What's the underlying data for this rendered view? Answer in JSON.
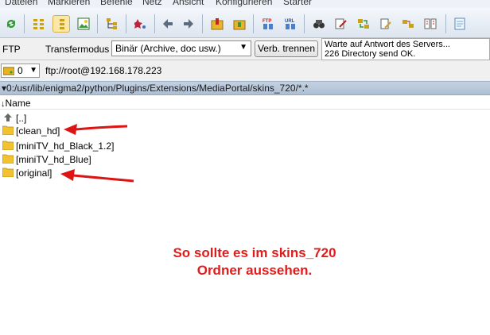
{
  "menu": [
    "Dateien",
    "Markieren",
    "Befehle",
    "Netz",
    "Ansicht",
    "Konfigurieren",
    "Starter"
  ],
  "toolbar_icons": [
    "refresh-icon",
    "view-brief-icon",
    "view-full-icon",
    "view-thumbnails-icon",
    "tree-icon",
    "compare-icon",
    "back-icon",
    "forward-icon",
    "pack-icon",
    "unpack-icon",
    "ftp-connect-icon",
    "url-connect-icon",
    "search-icon",
    "multi-rename-icon",
    "sync-dirs-icon",
    "notepad-icon"
  ],
  "ftp": {
    "label": "FTP",
    "transfer_label": "Transfermodus",
    "transfer_value": "Binär (Archive, doc usw.)",
    "disconnect_label": "Verb. trennen",
    "log": [
      "Warte auf Antwort des Servers...",
      "226 Directory send OK."
    ]
  },
  "address": {
    "drive": "0",
    "host": "ftp://root@192.168.178.223"
  },
  "path": "0:/usr/lib/enigma2/python/Plugins/Extensions/MediaPortal/skins_720/*.*",
  "column_header": "Name",
  "files": [
    "[..]",
    "[clean_hd]",
    "[miniTV_hd_Black_1.2]",
    "[miniTV_hd_Blue]",
    "[original]"
  ],
  "annotation": [
    "So sollte es im skins_720",
    "Ordner aussehen."
  ],
  "colors": {
    "annotation": "#e21b1b",
    "arrow": "#dd1414",
    "folder": "#f2c230"
  }
}
